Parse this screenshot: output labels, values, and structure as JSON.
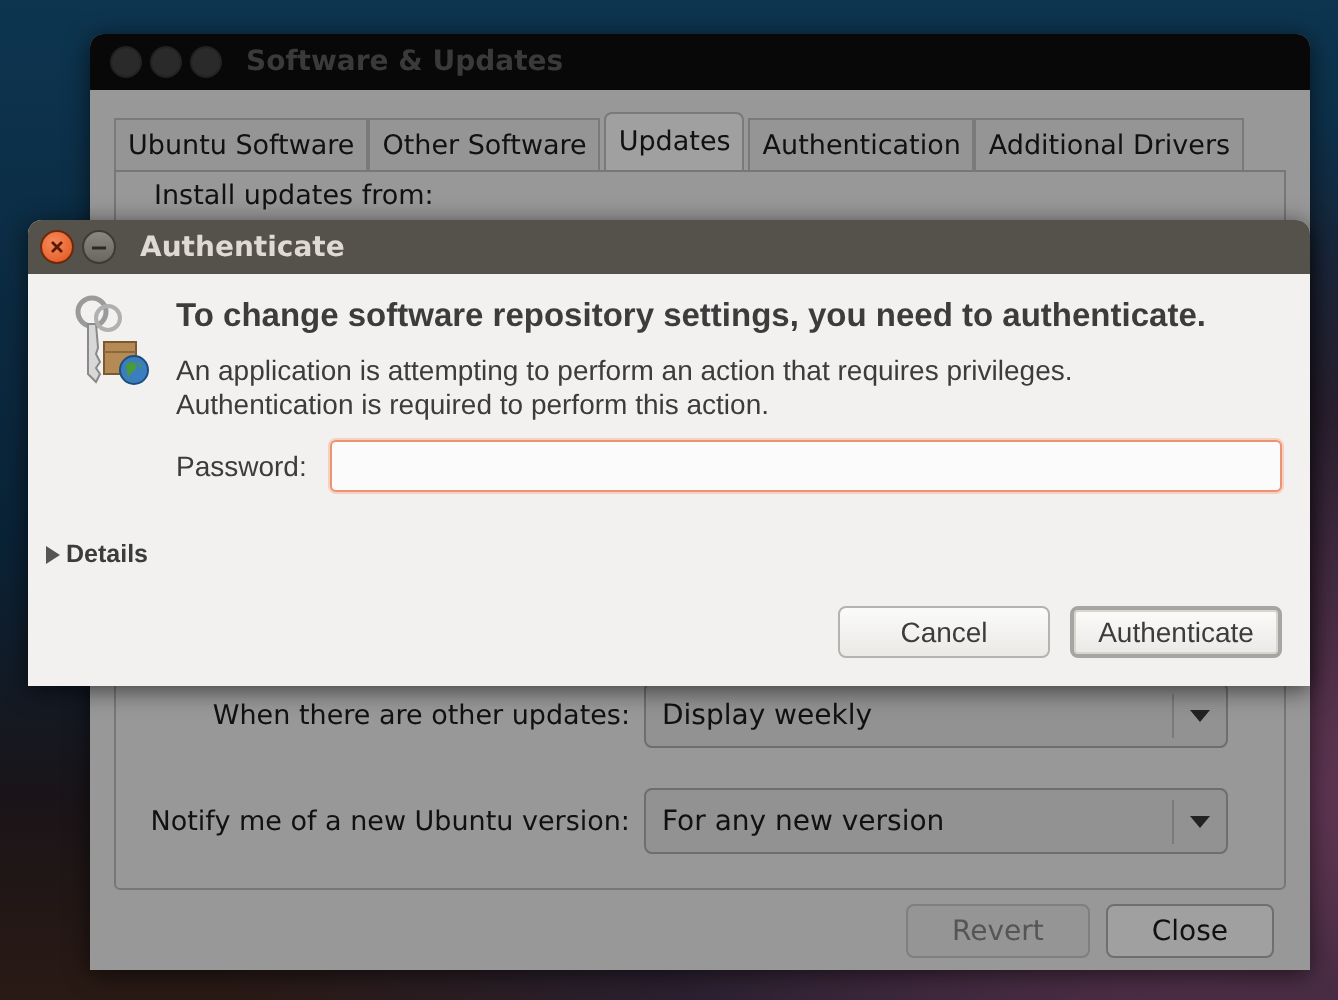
{
  "main_window": {
    "title": "Software & Updates",
    "active": false,
    "tabs": [
      {
        "label": "Ubuntu Software",
        "selected": false
      },
      {
        "label": "Other Software",
        "selected": false
      },
      {
        "label": "Updates",
        "selected": true
      },
      {
        "label": "Authentication",
        "selected": false
      },
      {
        "label": "Additional Drivers",
        "selected": false
      }
    ],
    "install_label": "Install updates from:",
    "settings": [
      {
        "label": "When there are other updates:",
        "value": "Display weekly"
      },
      {
        "label": "Notify me of a new Ubuntu version:",
        "value": "For any new version"
      }
    ],
    "buttons": [
      {
        "label": "Revert",
        "disabled": true
      },
      {
        "label": "Close",
        "disabled": false
      }
    ]
  },
  "dialog": {
    "title": "Authenticate",
    "active": true,
    "heading": "To change software repository settings, you need to authenticate.",
    "message": "An application is attempting to perform an action that requires privileges. Authentication is required to perform this action.",
    "password": {
      "label": "Password:",
      "focused": true
    },
    "details": {
      "label": "Details",
      "expanded": false
    },
    "buttons": [
      {
        "label": "Cancel",
        "default": false
      },
      {
        "label": "Authenticate",
        "default": true
      }
    ]
  }
}
